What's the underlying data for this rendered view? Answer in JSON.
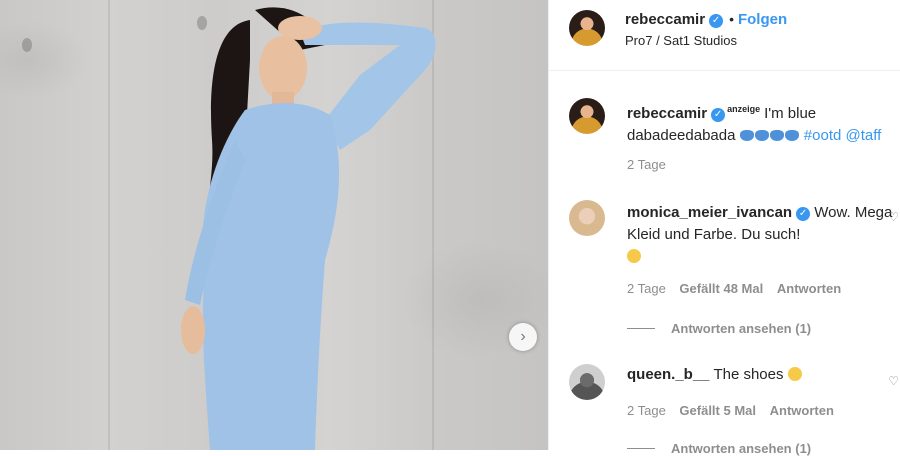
{
  "post": {
    "username": "rebeccamir",
    "follow_label": "Folgen",
    "location": "Pro7 / Sat1 Studios"
  },
  "caption": {
    "username": "rebeccamir",
    "badge": "anzeige",
    "text": "I'm blue dabadeedabada",
    "hashtags": "#ootd @taff",
    "time": "2 Tage"
  },
  "comments": [
    {
      "username": "monica_meier_ivancan",
      "text": "Wow. Mega Kleid und Farbe. Du such!",
      "time": "2 Tage",
      "likes": "Gefällt 48 Mal",
      "reply_label": "Antworten",
      "view_replies": "Antworten ansehen (1)"
    },
    {
      "username": "queen._b__",
      "text": "The shoes",
      "time": "2 Tage",
      "likes": "Gefällt 5 Mal",
      "reply_label": "Antworten",
      "view_replies": "Antworten ansehen (1)"
    }
  ],
  "icons": {
    "verified": "verified-badge-icon",
    "next": "chevron-right-icon",
    "heart": "heart-icon"
  },
  "colors": {
    "accent": "#3897f0",
    "meta_text": "#8e8e8e",
    "dress": "#9fc2e6"
  }
}
